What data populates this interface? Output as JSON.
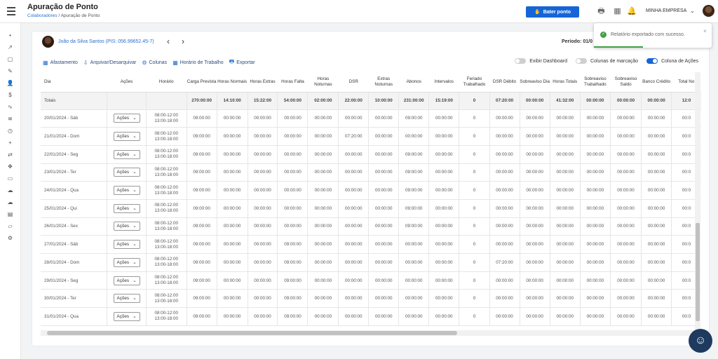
{
  "header": {
    "title": "Apuração de Ponto",
    "breadcrumb": {
      "root": "Colaboradores",
      "sep": "/",
      "current": "Apuração de Ponto"
    },
    "bater_ponto": "Bater ponto",
    "company": "MINHA EMPRESA"
  },
  "sidebar": {
    "icons": [
      "dot-icon",
      "trend-icon",
      "document-icon",
      "pen-icon",
      "user-icon",
      "dollar-icon",
      "pulse-icon",
      "layers-icon",
      "clock-icon",
      "plus-icon",
      "swap-icon",
      "move-icon",
      "book-icon",
      "cloud-upload-icon",
      "cloud-refresh-icon",
      "file-icon",
      "chat-icon",
      "settings-icon"
    ]
  },
  "employee": {
    "name": "João da Silva Santos (PIS: 056.99652.45-7)",
    "period": "Período: 01/0"
  },
  "toolbar": {
    "items": [
      "Afastamento",
      "Arquivar/Desarquivar",
      "Colunas",
      "Horário de Trabalho",
      "Exportar"
    ],
    "toggles": [
      {
        "label": "Exibir Dashboard",
        "on": false
      },
      {
        "label": "Colunas de marcação",
        "on": false
      },
      {
        "label": "Coluna de Ações",
        "on": true
      }
    ]
  },
  "table": {
    "headers": [
      "Dia",
      "Ações",
      "Horário",
      "Carga Prevista",
      "Horas Normais",
      "Horas Extras",
      "Horas Falta",
      "Horas Noturnas",
      "DSR",
      "Extras Noturnas",
      "Abonos",
      "Intervalos",
      "Feriado Trabalhado",
      "DSR Débito",
      "Sobreaviso Dia",
      "Horas Totais",
      "Sobreaviso Trabalhado",
      "Sobreaviso Saldo",
      "Banco Crédito",
      "Total No"
    ],
    "totals": [
      "Totais",
      "",
      "",
      "270:00:00",
      "14:10:00",
      "15:22:00",
      "54:00:00",
      "02:00:00",
      "22:00:00",
      "10:00:00",
      "231:00:00",
      "15:19:00",
      "0",
      "07:20:00",
      "00:00:00",
      "41:32:00",
      "00:00:00",
      "00:00:00",
      "00:00:00",
      "12:0"
    ],
    "action_label": "Ações",
    "rows": [
      {
        "day": "20/01/2024 - Sáb",
        "h1": "08:00-12:00",
        "h2": "13:00-18:00",
        "vals": [
          "09:00:00",
          "00:00:00",
          "00:00:00",
          "00:00:00",
          "00:00:00",
          "00:00:00",
          "00:00:00",
          "09:00:00",
          "00:00:00",
          "0",
          "00:00:00",
          "00:00:00",
          "00:00:00",
          "00:00:00",
          "00:00:00",
          "00:00:00",
          "00:0"
        ]
      },
      {
        "day": "21/01/2024 - Dom",
        "h1": "08:00-12:00",
        "h2": "13:00-18:00",
        "vals": [
          "09:00:00",
          "00:00:00",
          "00:00:00",
          "00:00:00",
          "00:00:00",
          "07:20:00",
          "00:00:00",
          "00:00:00",
          "00:00:00",
          "0",
          "00:00:00",
          "00:00:00",
          "00:00:00",
          "00:00:00",
          "00:00:00",
          "00:00:00",
          "00:0"
        ]
      },
      {
        "day": "22/01/2024 - Seg",
        "h1": "08:00-12:00",
        "h2": "13:00-18:00",
        "vals": [
          "09:00:00",
          "00:00:00",
          "00:00:00",
          "00:00:00",
          "00:00:00",
          "00:00:00",
          "00:00:00",
          "09:00:00",
          "00:00:00",
          "0",
          "00:00:00",
          "00:00:00",
          "00:00:00",
          "00:00:00",
          "00:00:00",
          "00:00:00",
          "00:0"
        ]
      },
      {
        "day": "23/01/2024 - Ter",
        "h1": "08:00-12:00",
        "h2": "13:00-18:00",
        "vals": [
          "09:00:00",
          "00:00:00",
          "00:00:00",
          "00:00:00",
          "00:00:00",
          "00:00:00",
          "00:00:00",
          "09:00:00",
          "00:00:00",
          "0",
          "00:00:00",
          "00:00:00",
          "00:00:00",
          "00:00:00",
          "00:00:00",
          "00:00:00",
          "00:0"
        ]
      },
      {
        "day": "24/01/2024 - Qua",
        "h1": "08:00-12:00",
        "h2": "13:00-18:00",
        "vals": [
          "09:00:00",
          "00:00:00",
          "00:00:00",
          "00:00:00",
          "00:00:00",
          "00:00:00",
          "00:00:00",
          "09:00:00",
          "00:00:00",
          "0",
          "00:00:00",
          "00:00:00",
          "00:00:00",
          "00:00:00",
          "00:00:00",
          "00:00:00",
          "00:0"
        ]
      },
      {
        "day": "25/01/2024 - Qui",
        "h1": "08:00-12:00",
        "h2": "13:00-18:00",
        "vals": [
          "09:00:00",
          "00:00:00",
          "00:00:00",
          "00:00:00",
          "00:00:00",
          "00:00:00",
          "00:00:00",
          "09:00:00",
          "00:00:00",
          "0",
          "00:00:00",
          "00:00:00",
          "00:00:00",
          "00:00:00",
          "00:00:00",
          "00:00:00",
          "00:0"
        ]
      },
      {
        "day": "26/01/2024 - Sex",
        "h1": "08:00-12:00",
        "h2": "13:00-18:00",
        "vals": [
          "09:00:00",
          "00:00:00",
          "00:00:00",
          "00:00:00",
          "00:00:00",
          "00:00:00",
          "00:00:00",
          "09:00:00",
          "00:00:00",
          "0",
          "00:00:00",
          "00:00:00",
          "00:00:00",
          "00:00:00",
          "00:00:00",
          "00:00:00",
          "00:0"
        ]
      },
      {
        "day": "27/01/2024 - Sáb",
        "h1": "08:00-12:00",
        "h2": "13:00-18:00",
        "vals": [
          "09:00:00",
          "00:00:00",
          "00:00:00",
          "09:00:00",
          "00:00:00",
          "00:00:00",
          "00:00:00",
          "00:00:00",
          "00:00:00",
          "0",
          "00:00:00",
          "00:00:00",
          "00:00:00",
          "00:00:00",
          "00:00:00",
          "00:00:00",
          "00:0"
        ]
      },
      {
        "day": "28/01/2024 - Dom",
        "h1": "08:00-12:00",
        "h2": "13:00-18:00",
        "vals": [
          "09:00:00",
          "00:00:00",
          "00:00:00",
          "09:00:00",
          "00:00:00",
          "00:00:00",
          "00:00:00",
          "00:00:00",
          "00:00:00",
          "0",
          "07:20:00",
          "00:00:00",
          "00:00:00",
          "00:00:00",
          "00:00:00",
          "00:00:00",
          "00:0"
        ]
      },
      {
        "day": "29/01/2024 - Seg",
        "h1": "08:00-12:00",
        "h2": "13:00-18:00",
        "vals": [
          "09:00:00",
          "00:00:00",
          "00:00:00",
          "09:00:00",
          "00:00:00",
          "00:00:00",
          "00:00:00",
          "00:00:00",
          "00:00:00",
          "0",
          "00:00:00",
          "00:00:00",
          "00:00:00",
          "00:00:00",
          "00:00:00",
          "00:00:00",
          "00:0"
        ]
      },
      {
        "day": "30/01/2024 - Ter",
        "h1": "08:00-12:00",
        "h2": "13:00-18:00",
        "vals": [
          "09:00:00",
          "00:00:00",
          "00:00:00",
          "09:00:00",
          "00:00:00",
          "00:00:00",
          "00:00:00",
          "00:00:00",
          "00:00:00",
          "0",
          "00:00:00",
          "00:00:00",
          "00:00:00",
          "00:00:00",
          "00:00:00",
          "00:00:00",
          "00:0"
        ]
      },
      {
        "day": "31/01/2024 - Qua",
        "h1": "08:00-12:00",
        "h2": "13:00-18:00",
        "vals": [
          "09:00:00",
          "00:00:00",
          "00:00:00",
          "09:00:00",
          "00:00:00",
          "00:00:00",
          "00:00:00",
          "00:00:00",
          "00:00:00",
          "0",
          "00:00:00",
          "00:00:00",
          "00:00:00",
          "00:00:00",
          "00:00:00",
          "00:00:00",
          "00:0"
        ]
      }
    ]
  },
  "toast": {
    "message": "Relatório exportado com sucesso."
  },
  "colors": {
    "primary": "#1565d8",
    "success": "#43a047"
  }
}
